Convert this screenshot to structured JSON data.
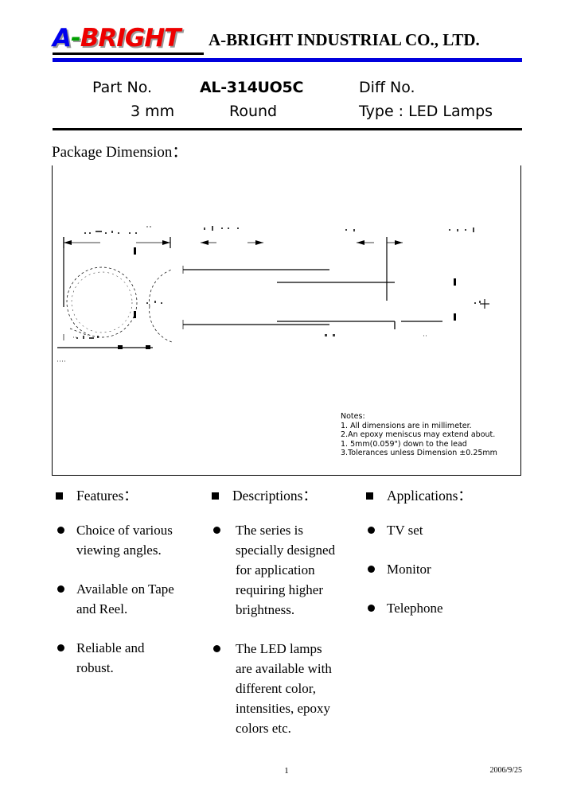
{
  "header": {
    "logo": {
      "a": "A",
      "dash": "-",
      "bright": "BRIGHT"
    },
    "company_name": "A-BRIGHT INDUSTRIAL CO., LTD.",
    "accent_color": "#0000dd",
    "logo_blue": "#0000ee",
    "logo_green": "#00a000",
    "logo_red": "#ee0000"
  },
  "part_table": {
    "part_no_label": "Part No.",
    "part_no_value": "AL-314UO5C",
    "diff_no_label": "Diff No.",
    "size_label": "3 mm",
    "shape_value": "Round",
    "type_label": "Type : LED Lamps"
  },
  "package_dimension": {
    "section_label": "Package Dimension：",
    "notes": [
      "Notes:",
      "1. All dimensions are in millimeter.",
      "2.An epoxy meniscus may extend about.",
      "  1. 5mm(0.059\") down to the lead",
      "3.Tolerances unless Dimension ±0.25mm"
    ]
  },
  "columns": [
    {
      "heading": "Features：",
      "items": [
        "Choice of various\nviewing angles.",
        "Available on Tape\nand Reel.",
        "Reliable and\nrobust."
      ]
    },
    {
      "heading": "Descriptions：",
      "items": [
        "The series is\nspecially designed\nfor application\nrequiring higher\nbrightness.",
        "The LED lamps\nare available with\ndifferent color,\nintensities, epoxy\ncolors etc."
      ]
    },
    {
      "heading": "Applications：",
      "items": [
        "TV set",
        "Monitor",
        "Telephone"
      ]
    }
  ],
  "footer": {
    "page_number": "1",
    "date": "2006/9/25"
  }
}
